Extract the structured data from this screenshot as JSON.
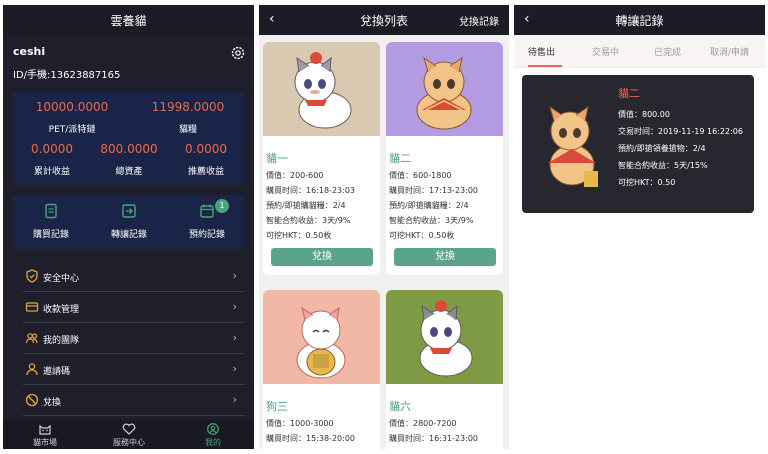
{
  "panel1": {
    "title": "雲養貓",
    "username": "ceshi",
    "phone": "ID/手機:13623887165",
    "stats_row1": [
      {
        "value": "10000.0000",
        "label": "PET/派特鏈"
      },
      {
        "value": "11998.0000",
        "label": "貓糧"
      }
    ],
    "stats_row2": [
      {
        "value": "0.0000",
        "label": "累計收益"
      },
      {
        "value": "800.0000",
        "label": "總資產"
      },
      {
        "value": "0.0000",
        "label": "推薦收益"
      }
    ],
    "actions": [
      {
        "label": "購買記錄",
        "icon": "purchase-record-icon"
      },
      {
        "label": "轉讓記錄",
        "icon": "transfer-record-icon"
      },
      {
        "label": "預約記錄",
        "icon": "reservation-record-icon",
        "badge": "1"
      }
    ],
    "menu": [
      {
        "label": "安全中心",
        "icon": "shield-icon"
      },
      {
        "label": "收款管理",
        "icon": "card-icon"
      },
      {
        "label": "我的團隊",
        "icon": "team-icon"
      },
      {
        "label": "邀請碼",
        "icon": "user-icon"
      },
      {
        "label": "兌換",
        "icon": "exchange-icon"
      }
    ],
    "tabbar": [
      {
        "label": "貓市場",
        "icon": "cat-icon",
        "active": false
      },
      {
        "label": "服務中心",
        "icon": "heart-icon",
        "active": false
      },
      {
        "label": "我的",
        "icon": "profile-icon",
        "active": true
      }
    ],
    "accent": "#e86a4a",
    "active_color": "#4aa37a"
  },
  "panel2": {
    "title": "兌換列表",
    "right_link": "兌換記錄",
    "cards": [
      {
        "name": "貓一",
        "price": "價值：200-600",
        "time": "購買时间：16:18-23:03",
        "reserve": "預約/即搶購貓糧：2/4",
        "profit": "智能合約收益：3天/9%",
        "hkt": "可挖HKT：0.50枚",
        "button": "兌換",
        "bg": "#d8c9b0"
      },
      {
        "name": "貓二",
        "price": "價值：600-1800",
        "time": "購買时间：17:13-23:00",
        "reserve": "預約/即搶購貓糧：2/4",
        "profit": "智能合約收益：3天/9%",
        "hkt": "可挖HKT：0.50枚",
        "button": "兌換",
        "bg": "#b29be0"
      },
      {
        "name": "狗三",
        "price": "價值：1000-3000",
        "time": "購買时间：15:38-20:00",
        "bg": "#f2b8a6"
      },
      {
        "name": "貓六",
        "price": "價值：2800-7200",
        "time": "購買时间：16:31-23:00",
        "bg": "#7e9a45"
      }
    ]
  },
  "panel3": {
    "title": "轉讓記錄",
    "tabs": [
      "待售出",
      "交易中",
      "已完成",
      "取消/申請"
    ],
    "record": {
      "name": "貓二",
      "price": "價值：800.00",
      "time": "交易时间：2019-11-19 16:22:06",
      "reserve": "預約/即搶領養搶物：2/4",
      "profit": "智能合約收益：5天/15%",
      "hkt": "可挖HKT：0.50"
    }
  }
}
